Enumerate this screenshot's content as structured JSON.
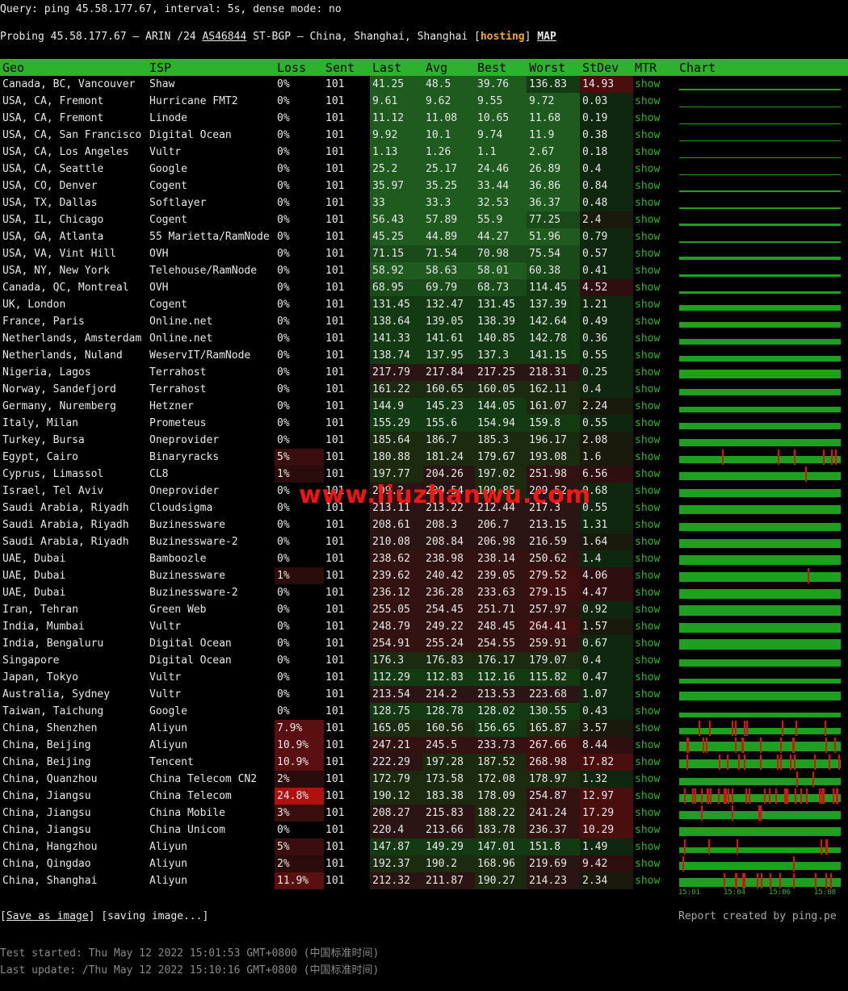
{
  "query_line": "Query: ping 45.58.177.67, interval: 5s, dense mode: no",
  "probe": {
    "prefix": "Probing 45.58.177.67 — ARIN /24 ",
    "asn": "AS46844",
    "mid": " ST-BGP — China, Shanghai, Shanghai [",
    "tag": "hosting",
    "close": "] ",
    "map": "MAP"
  },
  "headers": [
    "Geo",
    "ISP",
    "Loss",
    "Sent",
    "Last",
    "Avg",
    "Best",
    "Worst",
    "StDev",
    "MTR",
    "Chart"
  ],
  "rows": [
    [
      "Canada, BC, Vancouver",
      "Shaw",
      "0%",
      "101",
      "41.25",
      "48.5",
      "39.76",
      "136.83",
      "14.93",
      "show"
    ],
    [
      "USA, CA, Fremont",
      "Hurricane FMT2",
      "0%",
      "101",
      "9.61",
      "9.62",
      "9.55",
      "9.72",
      "0.03",
      "show"
    ],
    [
      "USA, CA, Fremont",
      "Linode",
      "0%",
      "101",
      "11.12",
      "11.08",
      "10.65",
      "11.68",
      "0.19",
      "show"
    ],
    [
      "USA, CA, San Francisco",
      "Digital Ocean",
      "0%",
      "101",
      "9.92",
      "10.1",
      "9.74",
      "11.9",
      "0.38",
      "show"
    ],
    [
      "USA, CA, Los Angeles",
      "Vultr",
      "0%",
      "101",
      "1.13",
      "1.26",
      "1.1",
      "2.67",
      "0.18",
      "show"
    ],
    [
      "USA, CA, Seattle",
      "Google",
      "0%",
      "101",
      "25.2",
      "25.17",
      "24.46",
      "26.89",
      "0.4",
      "show"
    ],
    [
      "USA, CO, Denver",
      "Cogent",
      "0%",
      "101",
      "35.97",
      "35.25",
      "33.44",
      "36.86",
      "0.84",
      "show"
    ],
    [
      "USA, TX, Dallas",
      "Softlayer",
      "0%",
      "101",
      "33",
      "33.3",
      "32.53",
      "36.37",
      "0.48",
      "show"
    ],
    [
      "USA, IL, Chicago",
      "Cogent",
      "0%",
      "101",
      "56.43",
      "57.89",
      "55.9",
      "77.25",
      "2.4",
      "show"
    ],
    [
      "USA, GA, Atlanta",
      "55 Marietta/RamNode",
      "0%",
      "101",
      "45.25",
      "44.89",
      "44.27",
      "51.96",
      "0.79",
      "show"
    ],
    [
      "USA, VA, Vint Hill",
      "OVH",
      "0%",
      "101",
      "71.15",
      "71.54",
      "70.98",
      "75.54",
      "0.57",
      "show"
    ],
    [
      "USA, NY, New York",
      "Telehouse/RamNode",
      "0%",
      "101",
      "58.92",
      "58.63",
      "58.01",
      "60.38",
      "0.41",
      "show"
    ],
    [
      "Canada, QC, Montreal",
      "OVH",
      "0%",
      "101",
      "68.95",
      "69.79",
      "68.73",
      "114.45",
      "4.52",
      "show"
    ],
    [
      "UK, London",
      "Cogent",
      "0%",
      "101",
      "131.45",
      "132.47",
      "131.45",
      "137.39",
      "1.21",
      "show"
    ],
    [
      "France, Paris",
      "Online.net",
      "0%",
      "101",
      "138.64",
      "139.05",
      "138.39",
      "142.64",
      "0.49",
      "show"
    ],
    [
      "Netherlands, Amsterdam",
      "Online.net",
      "0%",
      "101",
      "141.33",
      "141.61",
      "140.85",
      "142.78",
      "0.36",
      "show"
    ],
    [
      "Netherlands, Nuland",
      "WeservIT/RamNode",
      "0%",
      "101",
      "138.74",
      "137.95",
      "137.3",
      "141.15",
      "0.55",
      "show"
    ],
    [
      "Nigeria, Lagos",
      "Terrahost",
      "0%",
      "101",
      "217.79",
      "217.84",
      "217.25",
      "218.31",
      "0.25",
      "show"
    ],
    [
      "Norway, Sandefjord",
      "Terrahost",
      "0%",
      "101",
      "161.22",
      "160.65",
      "160.05",
      "162.11",
      "0.4",
      "show"
    ],
    [
      "Germany, Nuremberg",
      "Hetzner",
      "0%",
      "101",
      "144.9",
      "145.23",
      "144.05",
      "161.07",
      "2.24",
      "show"
    ],
    [
      "Italy, Milan",
      "Prometeus",
      "0%",
      "101",
      "155.29",
      "155.6",
      "154.94",
      "159.8",
      "0.55",
      "show"
    ],
    [
      "Turkey, Bursa",
      "Oneprovider",
      "0%",
      "101",
      "185.64",
      "186.7",
      "185.3",
      "196.17",
      "2.08",
      "show"
    ],
    [
      "Egypt, Cairo",
      "Binaryracks",
      "5%",
      "101",
      "180.88",
      "181.24",
      "179.67",
      "193.08",
      "1.6",
      "show"
    ],
    [
      "Cyprus, Limassol",
      "CL8",
      "1%",
      "101",
      "197.77",
      "204.26",
      "197.02",
      "251.98",
      "6.56",
      "show"
    ],
    [
      "Israel, Tel Aviv",
      "Oneprovider",
      "0%",
      "101",
      "209.2",
      "209.54",
      "199.85",
      "209.52",
      "0.68",
      "show"
    ],
    [
      "Saudi Arabia, Riyadh",
      "Cloudsigma",
      "0%",
      "101",
      "213.11",
      "213.22",
      "212.44",
      "217.3",
      "0.55",
      "show"
    ],
    [
      "Saudi Arabia, Riyadh",
      "Buzinessware",
      "0%",
      "101",
      "208.61",
      "208.3",
      "206.7",
      "213.15",
      "1.31",
      "show"
    ],
    [
      "Saudi Arabia, Riyadh",
      "Buzinessware-2",
      "0%",
      "101",
      "210.08",
      "208.84",
      "206.98",
      "216.59",
      "1.64",
      "show"
    ],
    [
      "UAE, Dubai",
      "Bamboozle",
      "0%",
      "101",
      "238.62",
      "238.98",
      "238.14",
      "250.62",
      "1.4",
      "show"
    ],
    [
      "UAE, Dubai",
      "Buzinessware",
      "1%",
      "101",
      "239.62",
      "240.42",
      "239.05",
      "279.52",
      "4.06",
      "show"
    ],
    [
      "UAE, Dubai",
      "Buzinessware-2",
      "0%",
      "101",
      "236.12",
      "236.28",
      "233.63",
      "279.15",
      "4.47",
      "show"
    ],
    [
      "Iran, Tehran",
      "Green Web",
      "0%",
      "101",
      "255.05",
      "254.45",
      "251.71",
      "257.97",
      "0.92",
      "show"
    ],
    [
      "India, Mumbai",
      "Vultr",
      "0%",
      "101",
      "248.79",
      "249.22",
      "248.45",
      "264.41",
      "1.57",
      "show"
    ],
    [
      "India, Bengaluru",
      "Digital Ocean",
      "0%",
      "101",
      "254.91",
      "255.24",
      "254.55",
      "259.91",
      "0.67",
      "show"
    ],
    [
      "Singapore",
      "Digital Ocean",
      "0%",
      "101",
      "176.3",
      "176.83",
      "176.17",
      "179.07",
      "0.4",
      "show"
    ],
    [
      "Japan, Tokyo",
      "Vultr",
      "0%",
      "101",
      "112.29",
      "112.83",
      "112.16",
      "115.82",
      "0.47",
      "show"
    ],
    [
      "Australia, Sydney",
      "Vultr",
      "0%",
      "101",
      "213.54",
      "214.2",
      "213.53",
      "223.68",
      "1.07",
      "show"
    ],
    [
      "Taiwan, Taichung",
      "Google",
      "0%",
      "101",
      "128.75",
      "128.78",
      "128.02",
      "130.55",
      "0.43",
      "show"
    ],
    [
      "China, Shenzhen",
      "Aliyun",
      "7.9%",
      "101",
      "165.05",
      "160.56",
      "156.65",
      "165.87",
      "3.57",
      "show"
    ],
    [
      "China, Beijing",
      "Aliyun",
      "10.9%",
      "101",
      "247.21",
      "245.5",
      "233.73",
      "267.66",
      "8.44",
      "show"
    ],
    [
      "China, Beijing",
      "Tencent",
      "10.9%",
      "101",
      "222.29",
      "197.28",
      "187.52",
      "268.98",
      "17.82",
      "show"
    ],
    [
      "China, Quanzhou",
      "China Telecom CN2",
      "2%",
      "101",
      "172.79",
      "173.58",
      "172.08",
      "178.97",
      "1.32",
      "show"
    ],
    [
      "China, Jiangsu",
      "China Telecom",
      "24.8%",
      "101",
      "190.12",
      "183.38",
      "178.09",
      "254.87",
      "12.97",
      "show"
    ],
    [
      "China, Jiangsu",
      "China Mobile",
      "3%",
      "101",
      "208.27",
      "215.83",
      "188.22",
      "241.24",
      "17.29",
      "show"
    ],
    [
      "China, Jiangsu",
      "China Unicom",
      "0%",
      "101",
      "220.4",
      "213.66",
      "183.78",
      "236.37",
      "10.29",
      "show"
    ],
    [
      "China, Hangzhou",
      "Aliyun",
      "5%",
      "101",
      "147.87",
      "149.29",
      "147.01",
      "151.8",
      "1.49",
      "show"
    ],
    [
      "China, Qingdao",
      "Aliyun",
      "2%",
      "101",
      "192.37",
      "190.2",
      "168.96",
      "219.69",
      "9.42",
      "show"
    ],
    [
      "China, Shanghai",
      "Aliyun",
      "11.9%",
      "101",
      "212.32",
      "211.87",
      "190.27",
      "214.23",
      "2.34",
      "show"
    ]
  ],
  "chart_times": [
    "15:01",
    "15:04",
    "15:06",
    "15:08"
  ],
  "watermark": "www.liuzhanwu.com",
  "save": {
    "open": "[",
    "link": "Save as image",
    "close": "] [saving image...]"
  },
  "report": "Report created by ping.pe",
  "test_started": "Test started: Thu May 12 2022 15:01:53 GMT+0800 (中国标准时间)",
  "last_update": "Last update: /Thu May 12 2022 15:10:16 GMT+0800 (中国标准时间)",
  "colors": {
    "header_bg": "#2db22d",
    "show_link": "#2db52d",
    "chart_bar": "#1f9f1f",
    "loss_spike": "#e01010",
    "hosting_tag": "#f5a623"
  }
}
